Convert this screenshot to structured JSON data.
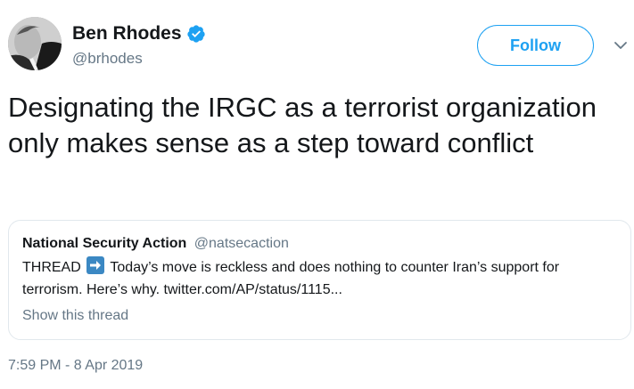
{
  "author": {
    "name": "Ben Rhodes",
    "handle": "@brhodes",
    "verified": true,
    "avatar_icon": "profile-photo"
  },
  "follow_button": {
    "label": "Follow"
  },
  "menu": {
    "icon": "chevron-down-icon"
  },
  "tweet": {
    "text": "Designating the IRGC as a terrorist organization only makes sense as a step toward conflict",
    "timestamp": "7:59 PM - 8 Apr 2019"
  },
  "quoted_tweet": {
    "name": "National Security Action",
    "handle": "@natsecaction",
    "body_prefix": "THREAD",
    "body_emoji_icon": "right-arrow-emoji",
    "body_text": "Today’s move is reckless and does nothing to counter Iran’s support for terrorism. Here’s why. twitter.com/AP/status/1115...",
    "show_thread_label": "Show this thread"
  },
  "colors": {
    "accent": "#1da1f2",
    "text": "#14171a",
    "secondary_text": "#657786",
    "card_border": "#e1e8ed",
    "emoji_blue": "#3b88c3"
  }
}
